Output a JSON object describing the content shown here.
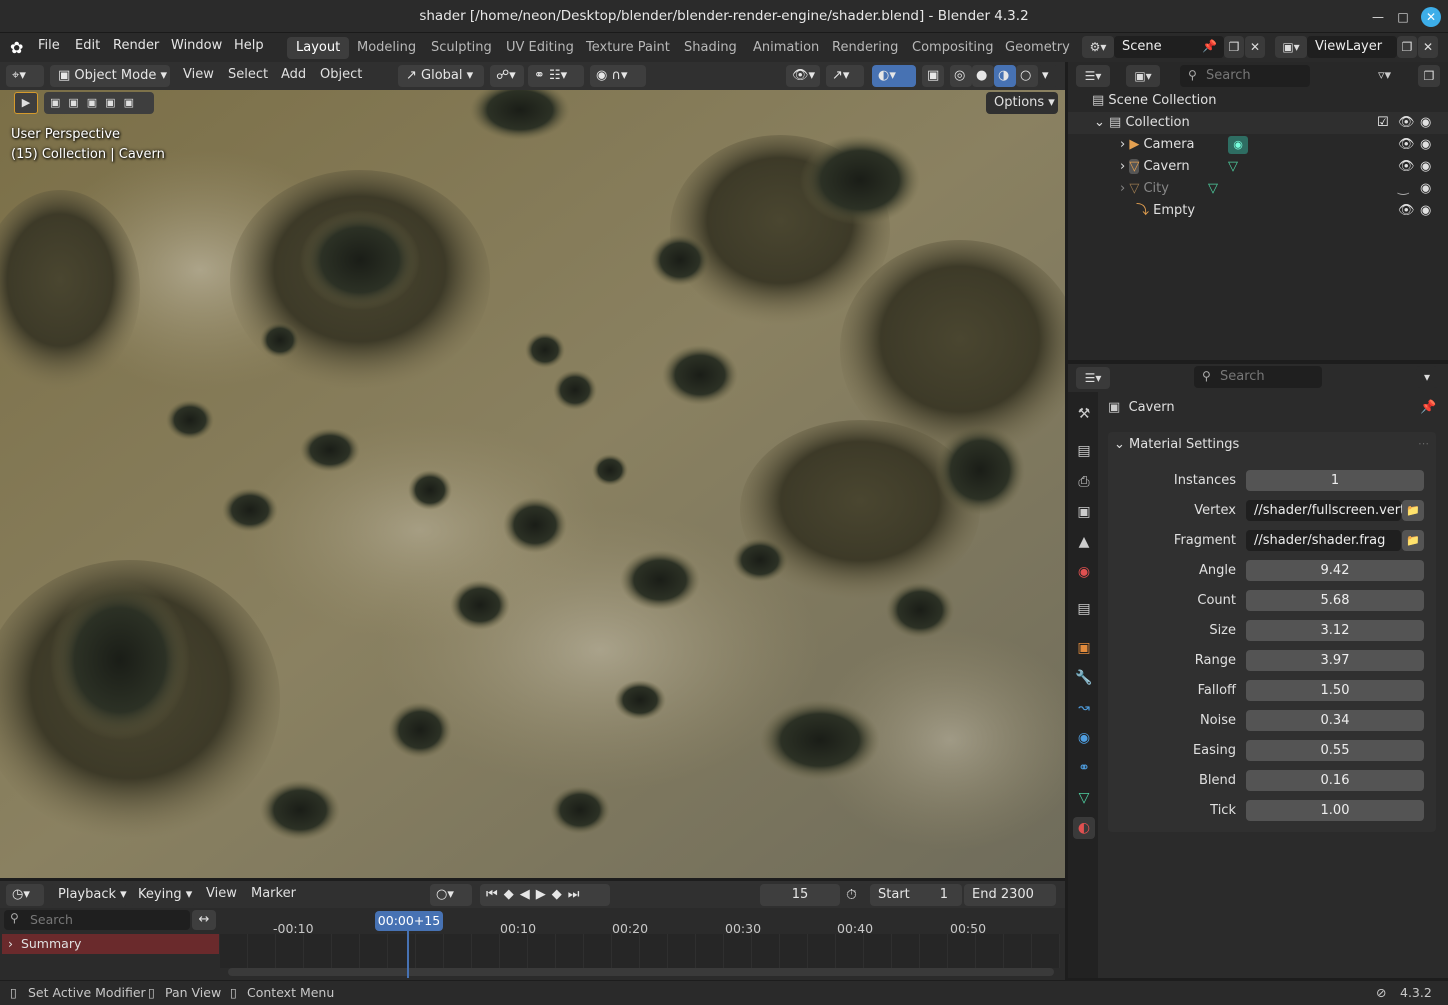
{
  "window": {
    "title": "shader [/home/neon/Desktop/blender/blender-render-engine/shader.blend] - Blender 4.3.2"
  },
  "menus": [
    "File",
    "Edit",
    "Render",
    "Window",
    "Help"
  ],
  "workspaces": [
    "Layout",
    "Modeling",
    "Sculpting",
    "UV Editing",
    "Texture Paint",
    "Shading",
    "Animation",
    "Rendering",
    "Compositing",
    "Geometry N"
  ],
  "active_workspace": "Layout",
  "scene": {
    "name": "Scene",
    "view_layer": "ViewLayer"
  },
  "viewport": {
    "mode": "Object Mode",
    "menus": [
      "View",
      "Select",
      "Add",
      "Object"
    ],
    "orientation": "Global",
    "options_label": "Options",
    "overlay_line1": "User Perspective",
    "overlay_line2": "(15) Collection | Cavern"
  },
  "outliner": {
    "search_placeholder": "Search",
    "scene_collection": "Scene Collection",
    "collection": "Collection",
    "items": [
      {
        "name": "Camera",
        "color": "#e4a050"
      },
      {
        "name": "Cavern",
        "color": "#e4a050"
      },
      {
        "name": "City",
        "color": "#e4a050"
      },
      {
        "name": "Empty",
        "color": "#e4a050"
      }
    ]
  },
  "properties": {
    "search_placeholder": "Search",
    "object_name": "Cavern",
    "panel_title": "Material Settings",
    "rows": [
      {
        "label": "Instances",
        "value": "1"
      },
      {
        "label": "Vertex",
        "value": "//shader/fullscreen.vert"
      },
      {
        "label": "Fragment",
        "value": "//shader/shader.frag"
      },
      {
        "label": "Angle",
        "value": "9.42"
      },
      {
        "label": "Count",
        "value": "5.68"
      },
      {
        "label": "Size",
        "value": "3.12"
      },
      {
        "label": "Range",
        "value": "3.97"
      },
      {
        "label": "Falloff",
        "value": "1.50"
      },
      {
        "label": "Noise",
        "value": "0.34"
      },
      {
        "label": "Easing",
        "value": "0.55"
      },
      {
        "label": "Blend",
        "value": "0.16"
      },
      {
        "label": "Tick",
        "value": "1.00"
      }
    ]
  },
  "timeline": {
    "menus": [
      "Playback",
      "Keying",
      "View",
      "Marker"
    ],
    "current_frame": "15",
    "start_label": "Start",
    "start_value": "1",
    "end_label": "End",
    "end_value": "2300",
    "search_placeholder": "Search",
    "summary": "Summary",
    "playhead_label": "00:00+15",
    "ticks": [
      "-00:10",
      "00:10",
      "00:20",
      "00:30",
      "00:40",
      "00:50"
    ]
  },
  "statusbar": {
    "items": [
      "Set Active Modifier",
      "Pan View",
      "Context Menu"
    ],
    "version": "4.3.2"
  }
}
